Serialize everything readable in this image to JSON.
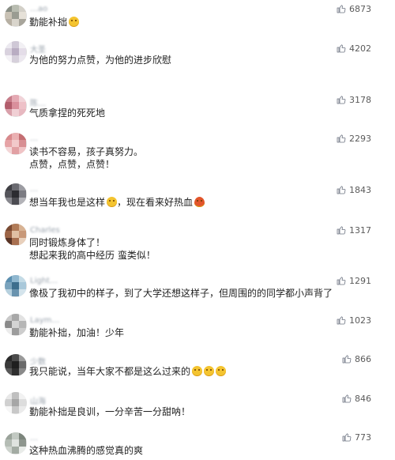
{
  "colors": {
    "count_text": "#5a5a5a",
    "name_text": "#9aa3ad",
    "comment_text": "#222222"
  },
  "icons": {
    "like": "thumbs-up-icon"
  },
  "comments": [
    {
      "name": "…ao",
      "lines": [
        "勤能补拙"
      ],
      "emoji_after": [
        "smiling-face-emoji"
      ],
      "likes": "6873"
    },
    {
      "name": "大圣",
      "lines": [
        "为他的努力点赞，为他的进步欣慰"
      ],
      "likes": "4202"
    },
    {
      "name": "陈…",
      "lines": [
        "气质拿捏的死死地"
      ],
      "likes": "3178"
    },
    {
      "name": "…",
      "lines": [
        "读书不容易，孩子真努力。",
        "点赞，点赞，点赞！"
      ],
      "likes": "2293"
    },
    {
      "name": "…",
      "lines": [
        "想当年我也是这样",
        "，现在看来好热血"
      ],
      "emojis": [
        "grinning-face-emoji",
        "fire-emoji"
      ],
      "likes": "1843"
    },
    {
      "name": "Charles",
      "lines": [
        "同时锻炼身体了！",
        "想起来我的高中经历 蛮类似！"
      ],
      "likes": "1317"
    },
    {
      "name": "Light…",
      "lines": [
        "像极了我初中的样子，到了大学还想这样子，但周围的的同学都小声背了"
      ],
      "likes": "1291"
    },
    {
      "name": "Laym…",
      "lines": [
        "勤能补拙，加油！少年"
      ],
      "likes": "1023"
    },
    {
      "name": "少数",
      "lines": [
        "我只能说，当年大家不都是这么过来的"
      ],
      "emoji_after": [
        "laughing-face-emoji",
        "laughing-face-emoji",
        "laughing-face-emoji"
      ],
      "likes": "866"
    },
    {
      "name": "山海",
      "lines": [
        "勤能补拙是良训，一分辛苦一分甜呐！"
      ],
      "likes": "846"
    },
    {
      "name": "…",
      "lines": [
        "这种热血沸腾的感觉真的爽"
      ],
      "likes": "773"
    }
  ]
}
